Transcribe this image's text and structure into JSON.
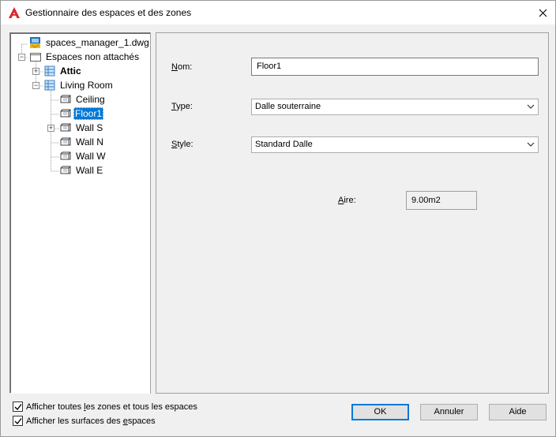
{
  "window": {
    "title": "Gestionnaire des espaces et des zones",
    "accent": "#0078d7"
  },
  "tree": {
    "nodes": [
      {
        "label": "spaces_manager_1.dwg",
        "icon": "drawing-file-icon"
      },
      {
        "label": "Espaces non attachés",
        "icon": "folder-icon",
        "expanded": true
      },
      {
        "label": "Attic",
        "icon": "zone-icon",
        "bold": true,
        "expanded": false
      },
      {
        "label": "Living Room",
        "icon": "zone-icon",
        "expanded": true
      },
      {
        "label": "Ceiling",
        "icon": "space-surface-icon"
      },
      {
        "label": "Floor1",
        "icon": "space-surface-icon",
        "selected": true
      },
      {
        "label": "Wall S",
        "icon": "space-surface-icon",
        "expanded": false
      },
      {
        "label": "Wall N",
        "icon": "space-surface-icon"
      },
      {
        "label": "Wall W",
        "icon": "space-surface-icon"
      },
      {
        "label": "Wall E",
        "icon": "space-surface-icon"
      }
    ]
  },
  "props": {
    "name_label_u": "N",
    "name_label_rest": "om:",
    "name_value": "Floor1",
    "type_label_u": "T",
    "type_label_rest": "ype:",
    "type_value": "Dalle souterraine",
    "style_label_u": "S",
    "style_label_rest": "tyle:",
    "style_value": "Standard Dalle",
    "area_label_u": "A",
    "area_label_rest": "ire:",
    "area_value": "9.00m2"
  },
  "options": {
    "show_all_pre": "Afficher toutes ",
    "show_all_u": "l",
    "show_all_post": "es zones et tous les espaces",
    "show_surfaces_pre": "Afficher les surfaces des ",
    "show_surfaces_u": "e",
    "show_surfaces_post": "spaces",
    "show_all_checked": true,
    "show_surfaces_checked": true
  },
  "buttons": {
    "ok": "OK",
    "cancel": "Annuler",
    "help": "Aide"
  }
}
